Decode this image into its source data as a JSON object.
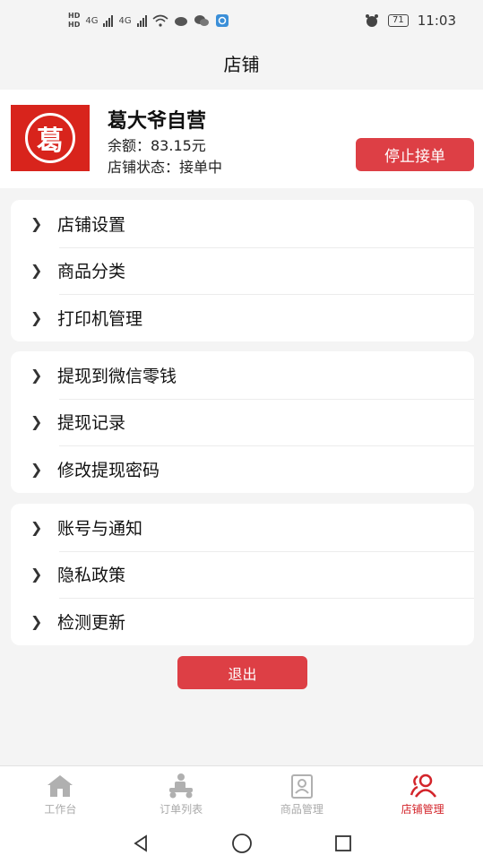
{
  "status_bar": {
    "hd1": "HD",
    "hd2": "HD",
    "net1": "4G",
    "net2": "4G",
    "battery": "71",
    "time": "11:03"
  },
  "header": {
    "title": "店铺"
  },
  "shop": {
    "logo_char": "葛",
    "name": "葛大爷自营",
    "balance": "余额：83.15元",
    "status": "店铺状态：接单中",
    "stop_button": "停止接单"
  },
  "menu_groups": [
    [
      "店铺设置",
      "商品分类",
      "打印机管理"
    ],
    [
      "提现到微信零钱",
      "提现记录",
      "修改提现密码"
    ],
    [
      "账号与通知",
      "隐私政策",
      "检测更新"
    ]
  ],
  "logout_button": "退出",
  "tabs": [
    {
      "label": "工作台",
      "icon": "home-icon",
      "active": false
    },
    {
      "label": "订单列表",
      "icon": "delivery-icon",
      "active": false
    },
    {
      "label": "商品管理",
      "icon": "product-icon",
      "active": false
    },
    {
      "label": "店铺管理",
      "icon": "shop-manage-icon",
      "active": true
    }
  ],
  "colors": {
    "accent": "#dd3f45",
    "active_tab": "#d3242a",
    "logo_bg": "#d8241c"
  }
}
